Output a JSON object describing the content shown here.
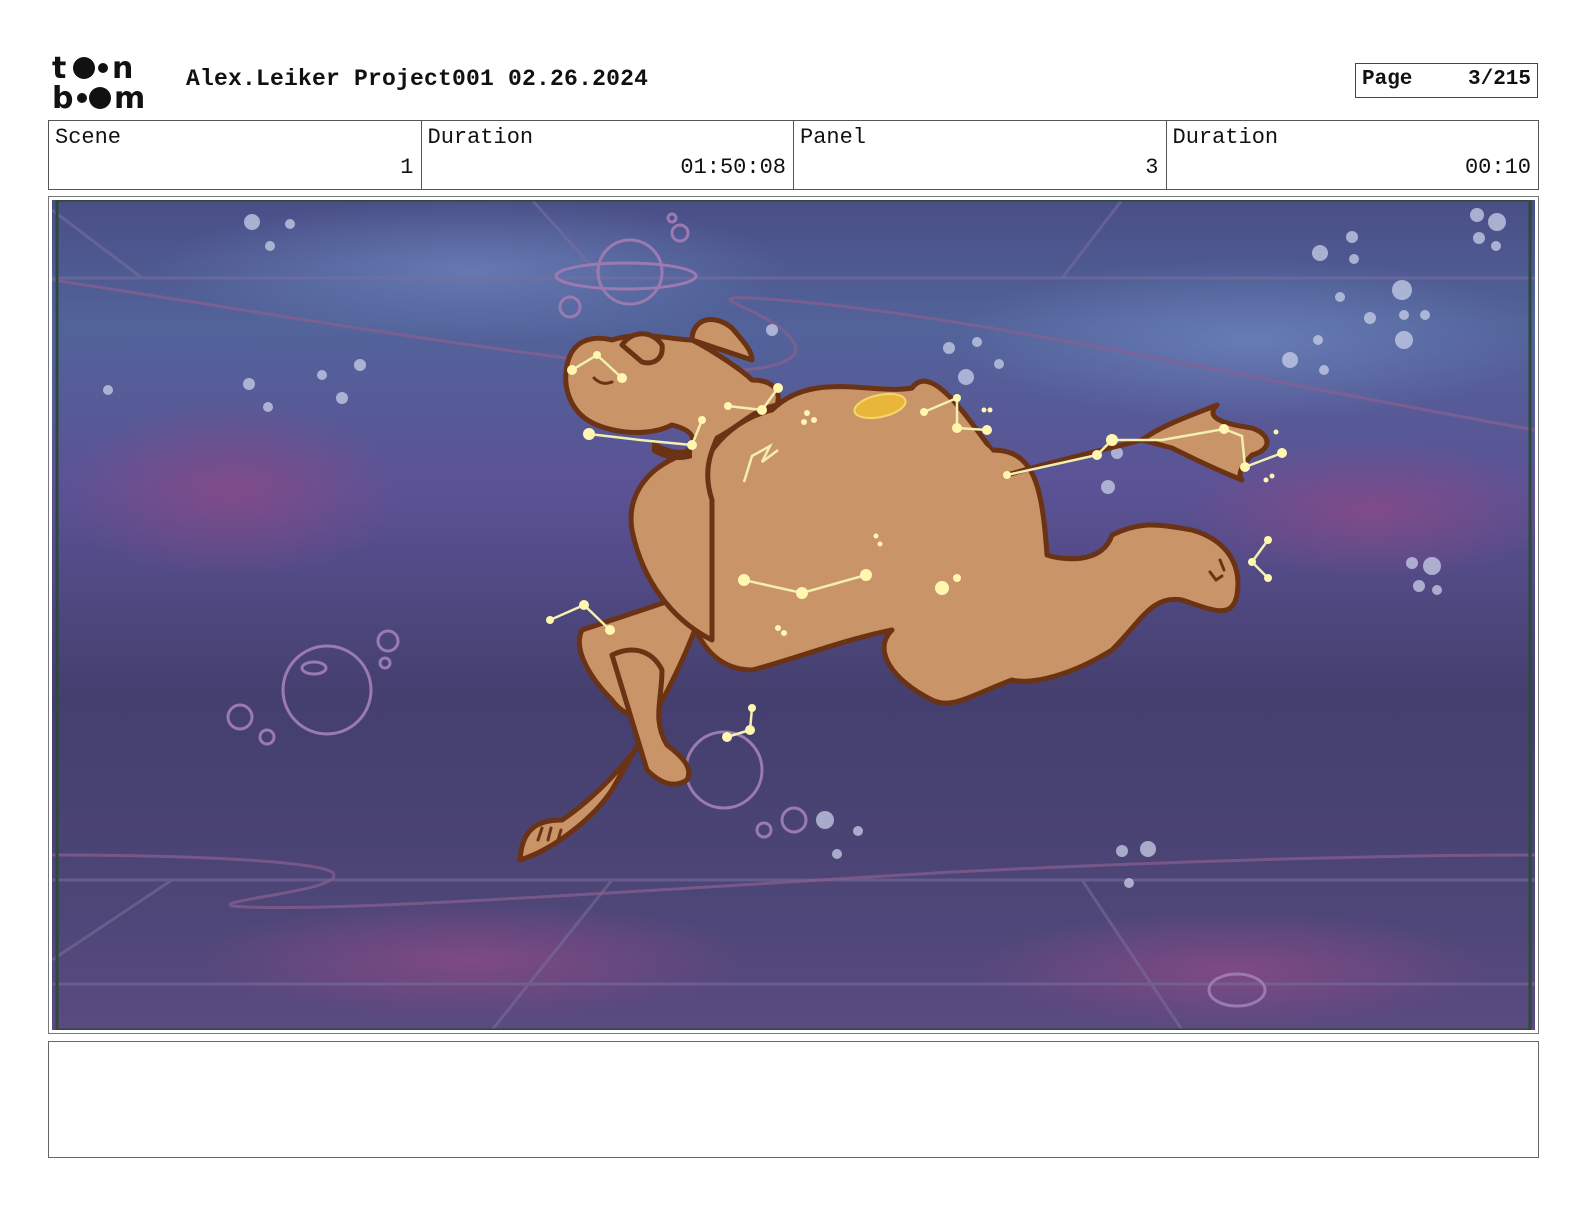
{
  "header": {
    "logo_text": "toon boom",
    "title": "Alex.Leiker Project001 02.26.2024",
    "page_label": "Page",
    "page_value": "3/215"
  },
  "info": {
    "scene_label": "Scene",
    "scene_value": "1",
    "duration_label": "Duration",
    "duration_value": "01:50:08",
    "panel_label": "Panel",
    "panel_value": "3",
    "panel_duration_label": "Duration",
    "panel_duration_value": "00:10"
  },
  "panel": {
    "description": "",
    "colors": {
      "sky_top": "#4b4f86",
      "sky_mid": "#5a4f8f",
      "sky_bottom": "#3f3d66",
      "camel": "#c99468",
      "outline": "#6b3214",
      "stars": "#fff6b0",
      "frame": "#2e4a3a"
    }
  },
  "notes": {
    "text": ""
  }
}
